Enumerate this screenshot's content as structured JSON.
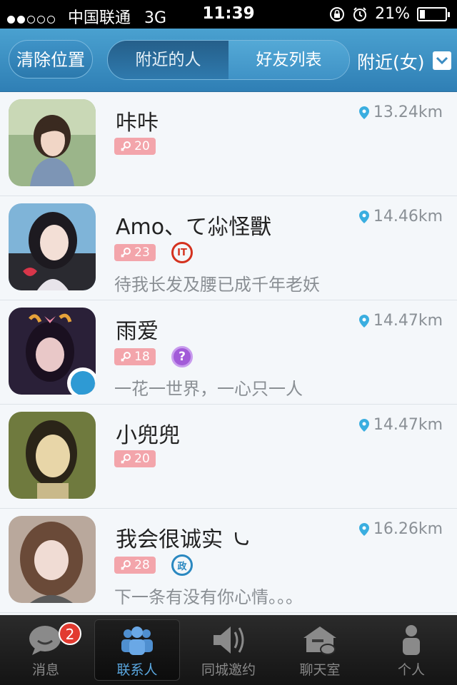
{
  "status_bar": {
    "carrier": "中国联通",
    "network": "3G",
    "time": "11:39",
    "battery": "21%",
    "battery_level": 0.21,
    "signal_dots_filled": 2,
    "signal_dots_total": 5
  },
  "header": {
    "clear_location_label": "清除位置",
    "tabs": [
      {
        "label": "附近的人",
        "active": true
      },
      {
        "label": "好友列表",
        "active": false
      }
    ],
    "filter_label": "附近(女)"
  },
  "people": [
    {
      "name": "咔咔",
      "distance": "13.24km",
      "age": "20",
      "tag": "",
      "signature": ""
    },
    {
      "name": "Amo、て尛怪獸",
      "distance": "14.46km",
      "age": "23",
      "tag": "IT",
      "signature": "待我长发及腰已成千年老妖"
    },
    {
      "name": "雨爱",
      "distance": "14.47km",
      "age": "18",
      "tag": "?",
      "signature": "一花一世界，一心只一人"
    },
    {
      "name": "小兜兜",
      "distance": "14.47km",
      "age": "20",
      "tag": "",
      "signature": ""
    },
    {
      "name": "我会很诚实 ㇃",
      "distance": "16.26km",
      "age": "28",
      "tag": "政",
      "signature": "下一条有没有你心情。。。"
    }
  ],
  "tabbar": {
    "items": [
      {
        "label": "消息",
        "icon": "chat-bubble-icon",
        "badge": "2"
      },
      {
        "label": "联系人",
        "icon": "contacts-icon",
        "active": true
      },
      {
        "label": "同城邀约",
        "icon": "megaphone-icon"
      },
      {
        "label": "聊天室",
        "icon": "chatroom-house-icon"
      },
      {
        "label": "个人",
        "icon": "person-icon"
      }
    ]
  },
  "colors": {
    "header_blue": "#3a8cc2",
    "age_badge_pink": "#f3a5ab",
    "active_tab_blue": "#5aa7e0",
    "badge_red": "#e23a30"
  }
}
